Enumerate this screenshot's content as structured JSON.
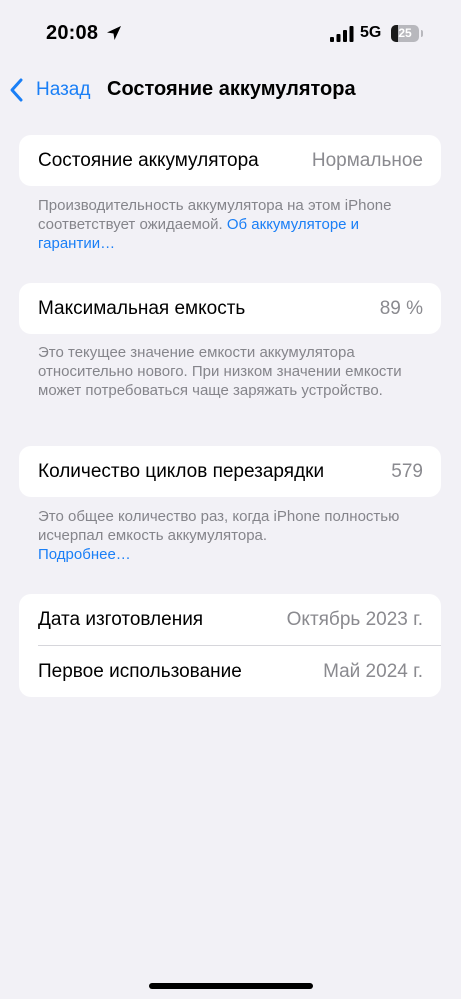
{
  "status_bar": {
    "time": "20:08",
    "network": "5G",
    "battery_level": "25",
    "battery_fraction": 0.25,
    "icons": [
      "location-arrow-icon",
      "cellular-signal-icon",
      "battery-icon"
    ]
  },
  "nav": {
    "back_label": "Назад",
    "title": "Состояние аккумулятора",
    "accent_color": "#1a7ff6"
  },
  "sections": {
    "health": {
      "label": "Состояние аккумулятора",
      "value": "Нормальное",
      "footnote": "Производительность аккумулятора на этом iPhone соответствует ожидаемой. ",
      "footnote_link": "Об аккумуляторе и гарантии…"
    },
    "capacity": {
      "label": "Максимальная емкость",
      "value": "89 %",
      "footnote": "Это текущее значение емкости аккумулятора относительно нового. При низком значении емкости может потребоваться чаще заряжать устройство."
    },
    "cycles": {
      "label": "Количество циклов перезарядки",
      "value": "579",
      "footnote": "Это общее количество раз, когда iPhone полностью исчерпал емкость аккумулятора.",
      "footnote_link": "Подробнее…"
    },
    "dates": {
      "manufacture_label": "Дата изготовления",
      "manufacture_value": "Октябрь 2023 г.",
      "first_use_label": "Первое использование",
      "first_use_value": "Май 2024 г."
    }
  }
}
